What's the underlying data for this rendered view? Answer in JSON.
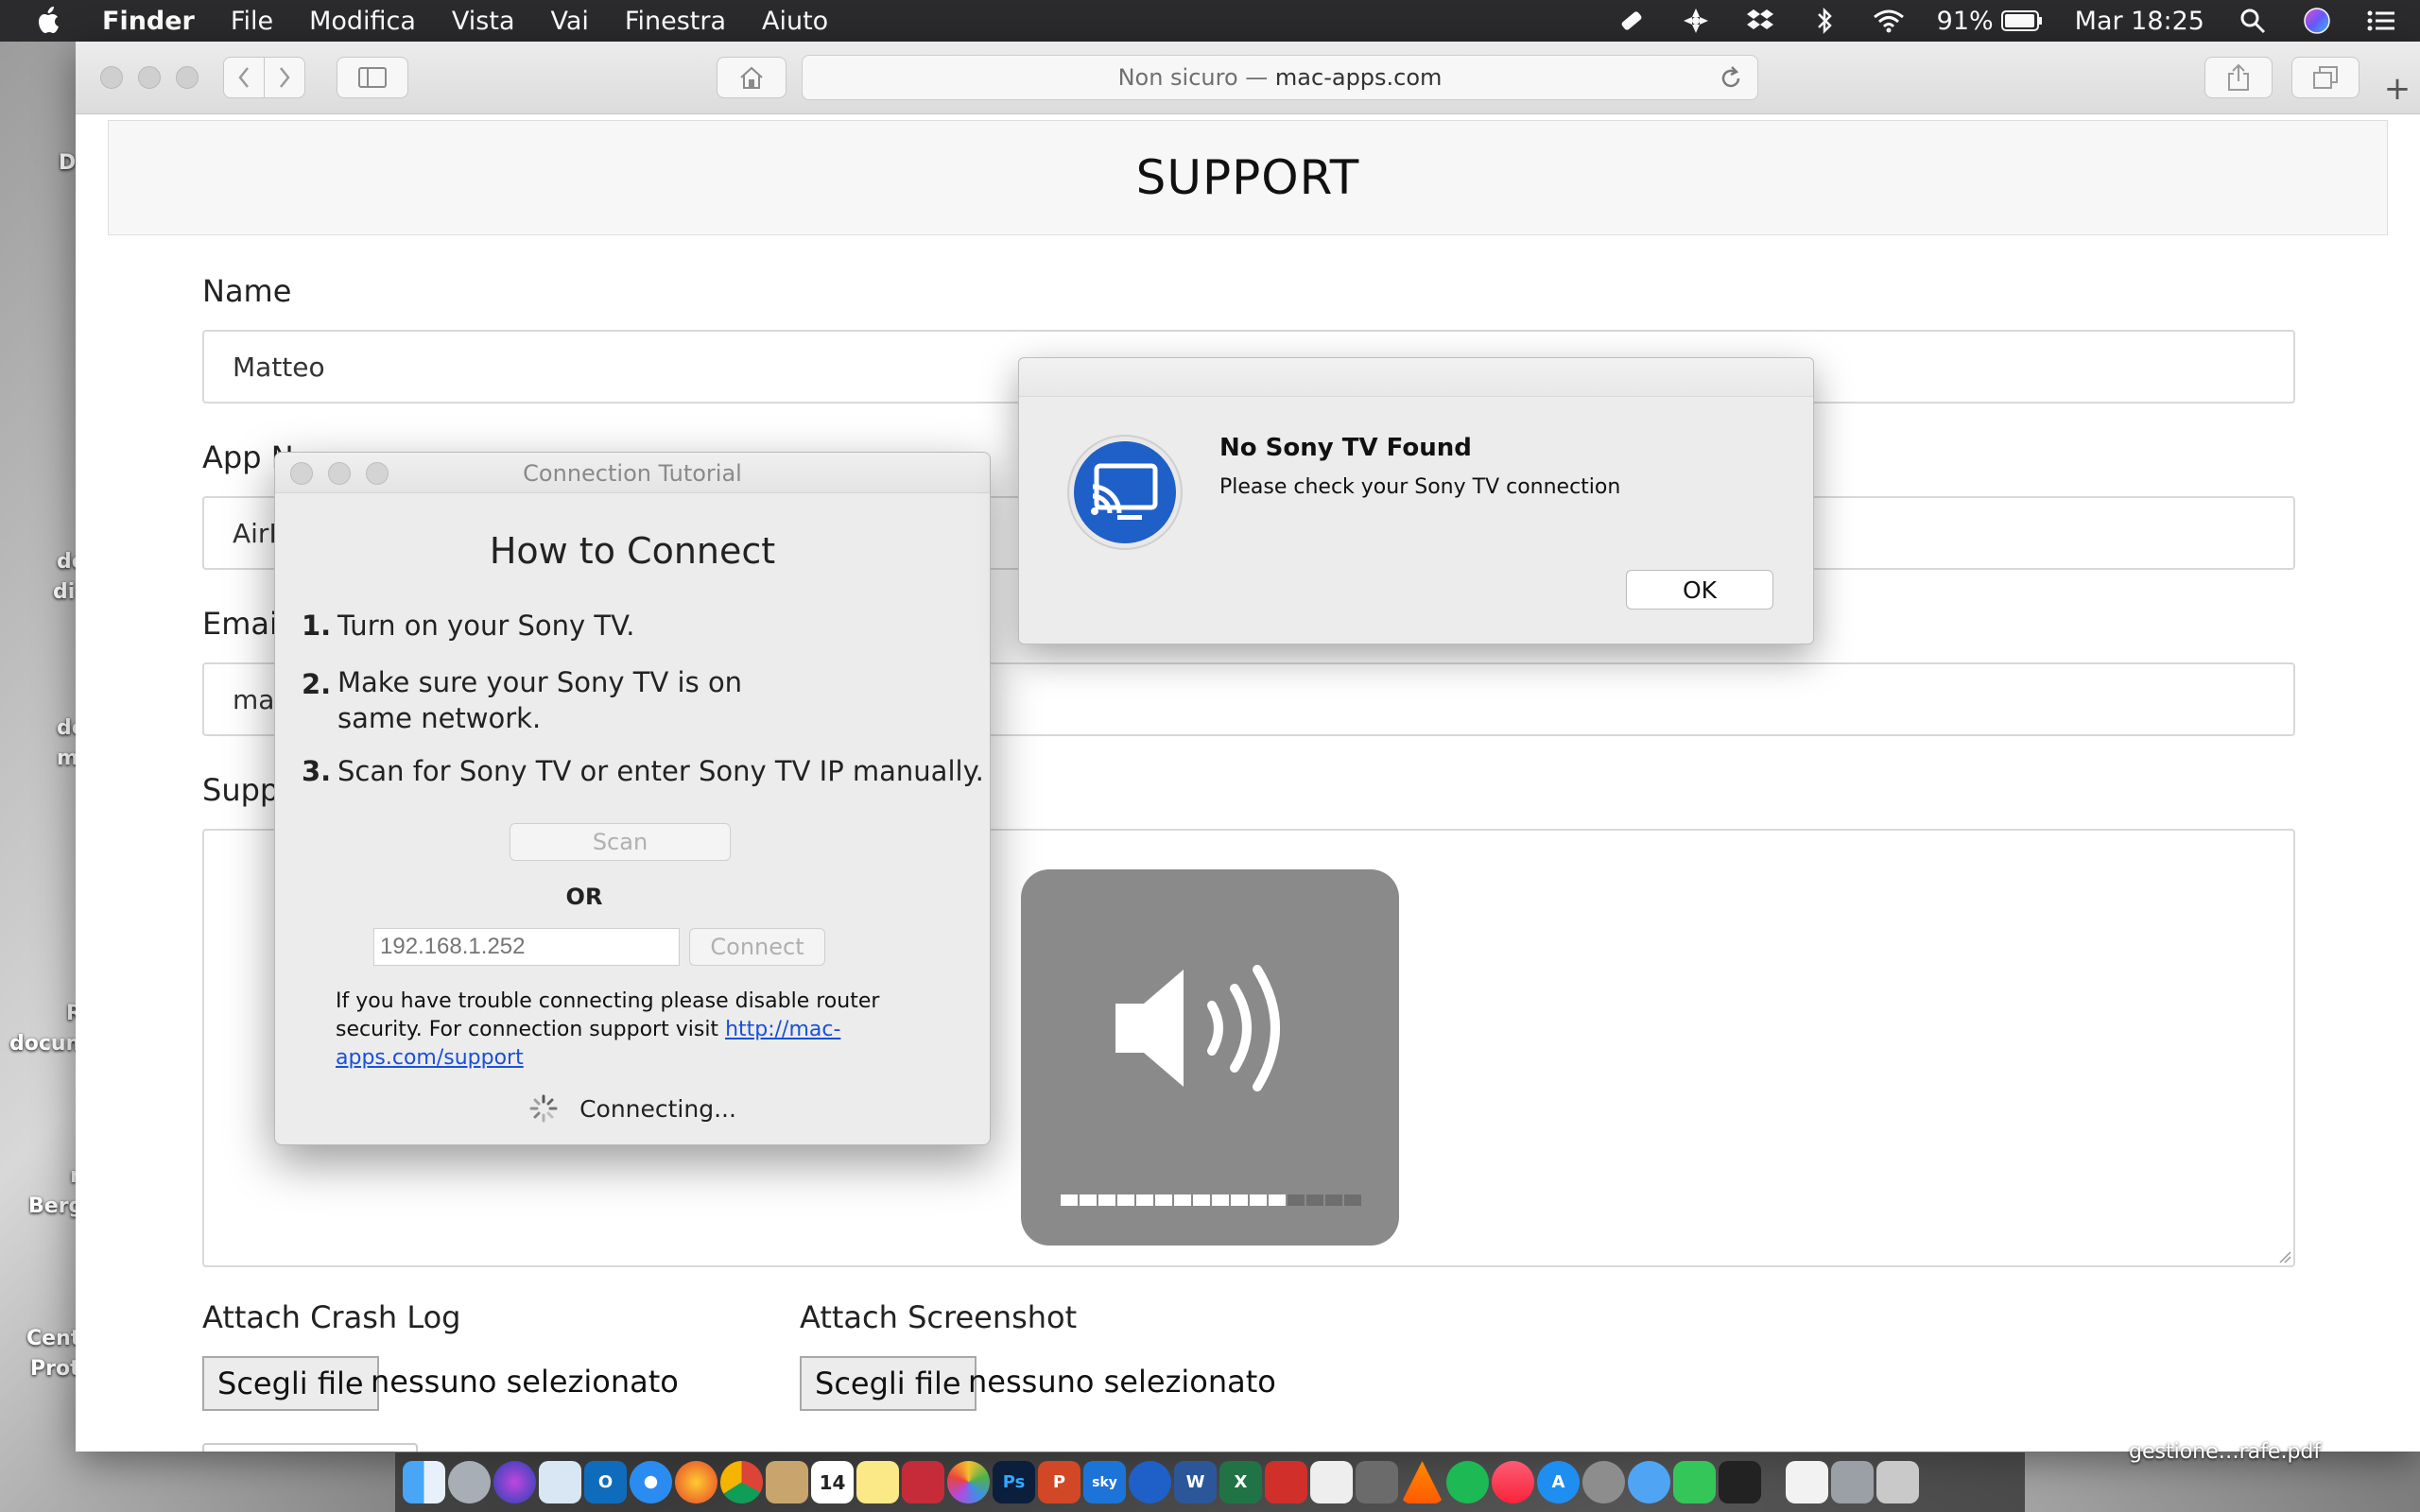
{
  "menubar": {
    "app_name": "Finder",
    "items": [
      "File",
      "Modifica",
      "Vista",
      "Vai",
      "Finestra",
      "Aiuto"
    ],
    "battery": "91%",
    "clock": "Mar 18:25"
  },
  "desktop_labels": [
    "D",
    "de",
    "di",
    "de",
    "m",
    "R",
    "docum",
    "r",
    "Berg",
    "Cent",
    "Prot"
  ],
  "safari": {
    "url_prefix": "Non sicuro —",
    "url_domain": "mac-apps.com",
    "new_tab": "+"
  },
  "page": {
    "heading": "SUPPORT",
    "name_label": "Name",
    "name_value": "Matteo",
    "app_label": "App N",
    "app_value": "AirP",
    "email_label": "Emai",
    "email_value": "ma",
    "support_label": "Supp",
    "crash_label": "Attach Crash Log",
    "screenshot_label": "Attach Screenshot",
    "choose_file": "Scegli file",
    "no_file": "nessuno selezionato"
  },
  "tutorial": {
    "window_title": "Connection Tutorial",
    "heading": "How to Connect",
    "steps": [
      {
        "num": "1.",
        "text": "Turn on your Sony TV."
      },
      {
        "num": "2.",
        "text": "Make sure your Sony TV is on",
        "text2": "same network."
      },
      {
        "num": "3.",
        "text": "Scan for Sony TV or enter Sony TV IP manually."
      }
    ],
    "scan_button": "Scan",
    "or_label": "OR",
    "ip_placeholder": "192.168.1.252",
    "connect_button": "Connect",
    "trouble_text": "If you have trouble connecting please disable router security. For connection support visit",
    "support_link": "http://mac-apps.com/support",
    "status": "Connecting..."
  },
  "alert": {
    "title": "No Sony TV Found",
    "message": "Please check your Sony TV connection",
    "ok_button": "OK"
  },
  "volume_hud": {
    "icon": "speaker-volume-icon",
    "level_fraction": 0.75
  },
  "dock": {
    "calendar_day": "14",
    "gestione_label": "gestione…rafe.pdf"
  },
  "colors": {
    "menubar_bg": "#2b2b2d",
    "link": "#1a4fd8",
    "airplay_icon_blue": "#1f5fc8"
  }
}
